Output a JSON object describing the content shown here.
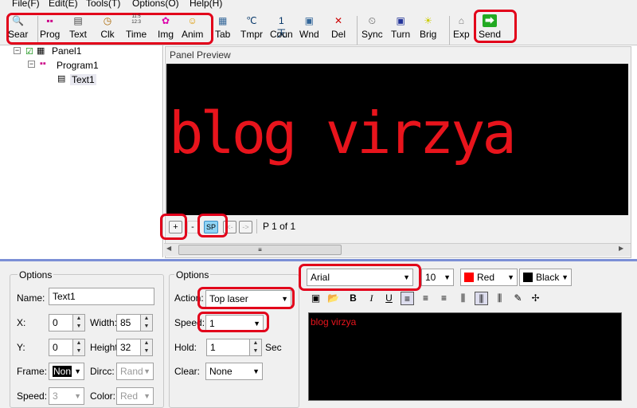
{
  "menu": [
    "File(F)",
    "Edit(E)",
    "Tools(T)",
    "Options(O)",
    "Help(H)"
  ],
  "toolbar": [
    {
      "label": "Sear",
      "icon": "search-icon",
      "glyph": "🔍"
    },
    {
      "label": "Prog",
      "icon": "program-icon",
      "glyph": "▪▪"
    },
    {
      "label": "Text",
      "icon": "text-icon",
      "glyph": "▤"
    },
    {
      "label": "Clk",
      "icon": "clock-icon",
      "glyph": "◷"
    },
    {
      "label": "Time",
      "icon": "time-icon",
      "glyph": "11:5\n12:3"
    },
    {
      "label": "Img",
      "icon": "image-icon",
      "glyph": "✿"
    },
    {
      "label": "Anim",
      "icon": "animation-icon",
      "glyph": "☺"
    },
    {
      "label": "Tab",
      "icon": "table-icon",
      "glyph": "▦"
    },
    {
      "label": "Tmpr",
      "icon": "temperature-icon",
      "glyph": "℃"
    },
    {
      "label": "Coun",
      "icon": "counter-icon",
      "glyph": "1天"
    },
    {
      "label": "Wnd",
      "icon": "window-icon",
      "glyph": "▣"
    },
    {
      "label": "Del",
      "icon": "delete-icon",
      "glyph": "✕"
    },
    {
      "label": "Sync",
      "icon": "sync-icon",
      "glyph": "⏲"
    },
    {
      "label": "Turn",
      "icon": "turn-icon",
      "glyph": "▣"
    },
    {
      "label": "Brig",
      "icon": "brightness-icon",
      "glyph": "☀"
    },
    {
      "label": "Exp",
      "icon": "export-icon",
      "glyph": "⌂"
    },
    {
      "label": "Send",
      "icon": "send-icon",
      "glyph": "⮕"
    }
  ],
  "tree": {
    "panel": "Panel1",
    "program": "Program1",
    "text": "Text1"
  },
  "preview": {
    "title": "Panel Preview",
    "led_text": "blog virzya",
    "page": "P 1 of 1",
    "buttons": [
      "+",
      "-",
      "SP",
      "<-",
      "->"
    ]
  },
  "options_left": {
    "title": "Options",
    "name_label": "Name:",
    "name_value": "Text1",
    "x_label": "X:",
    "x_value": "0",
    "width_label": "Width:",
    "width_value": "85",
    "y_label": "Y:",
    "y_value": "0",
    "height_label": "Height",
    "height_value": "32",
    "frame_label": "Frame:",
    "frame_value": "Non",
    "dirc_label": "Dircc:",
    "dirc_value": "Rand",
    "speed_label": "Speed:",
    "speed_value": "3",
    "color_label": "Color:",
    "color_value": "Red"
  },
  "options_mid": {
    "title": "Options",
    "action_label": "Action:",
    "action_value": "Top laser",
    "speed_label": "Speed:",
    "speed_value": "1",
    "hold_label": "Hold:",
    "hold_value": "1",
    "hold_unit": "Sec",
    "clear_label": "Clear:",
    "clear_value": "None"
  },
  "font": {
    "family": "Arial",
    "size": "10",
    "fg_label": "Red",
    "fg_color": "#ff0000",
    "bg_label": "Black",
    "bg_color": "#000000"
  },
  "editor": {
    "text": "blog virzya"
  },
  "colors": {
    "led": "#e8141c",
    "highlight": "#e2001a",
    "bottom_border": "#7b8fd6"
  }
}
